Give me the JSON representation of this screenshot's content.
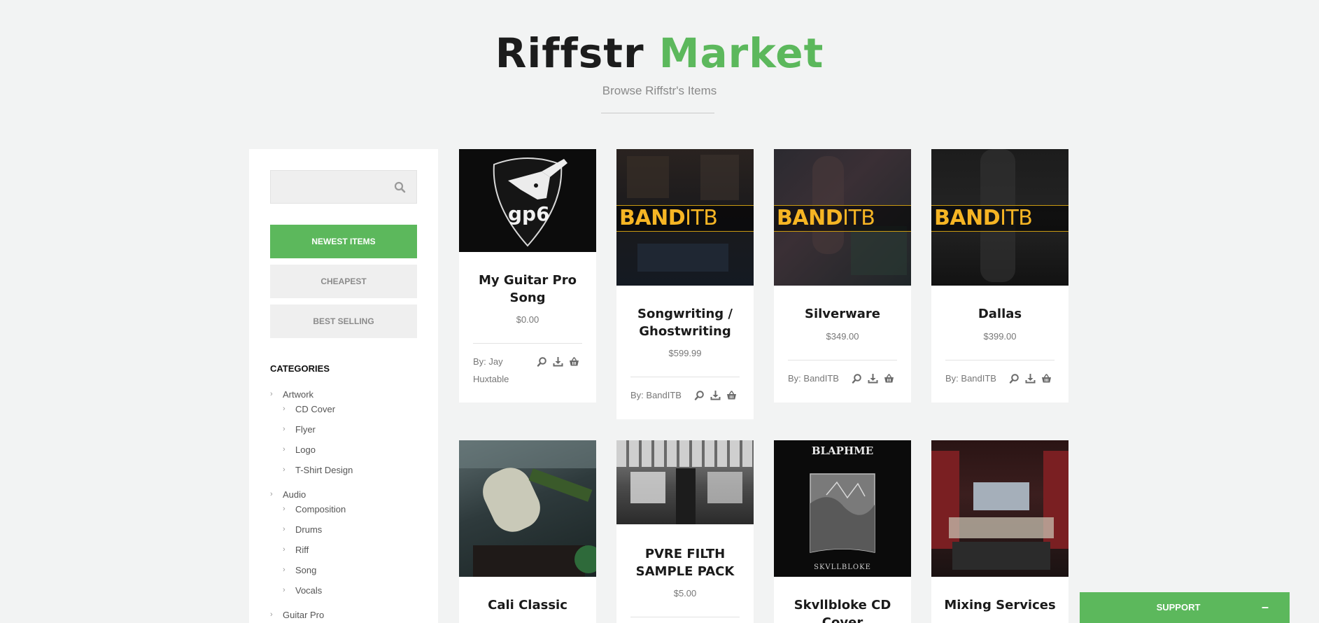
{
  "header": {
    "title_part1": "Riffstr",
    "title_part2": "Market",
    "subtitle": "Browse Riffstr's Items"
  },
  "search": {
    "placeholder": ""
  },
  "sort_buttons": [
    "NEWEST ITEMS",
    "CHEAPEST",
    "BEST SELLING"
  ],
  "categories": {
    "title": "CATEGORIES",
    "groups": [
      {
        "label": "Artwork",
        "children": [
          "CD Cover",
          "Flyer",
          "Logo",
          "T-Shirt Design"
        ]
      },
      {
        "label": "Audio",
        "children": [
          "Composition",
          "Drums",
          "Riff",
          "Song",
          "Vocals"
        ]
      },
      {
        "label": "Guitar Pro",
        "children": []
      }
    ]
  },
  "items": [
    {
      "title": "My Guitar Pro Song",
      "price": "$0.00",
      "seller": "By: Jay Huxtable",
      "image": "gp6-guitar-pick-logo"
    },
    {
      "title": "Songwriting / Ghostwriting",
      "price": "$599.99",
      "seller": "By: BandITB",
      "image": "banditb-studio-banner",
      "banner": [
        "BAND",
        "ITB"
      ]
    },
    {
      "title": "Silverware",
      "price": "$349.00",
      "seller": "By: BandITB",
      "image": "banditb-guitarist-banner",
      "banner": [
        "BAND",
        "ITB"
      ]
    },
    {
      "title": "Dallas",
      "price": "$399.00",
      "seller": "By: BandITB",
      "image": "banditb-stage-banner",
      "banner": [
        "BAND",
        "ITB"
      ]
    },
    {
      "title": "Cali Classic",
      "price": "",
      "seller": "",
      "image": "guitarist-jumping-photo"
    },
    {
      "title": "PVRE FILTH SAMPLE PACK",
      "price": "$5.00",
      "seller": "",
      "image": "abandoned-factory-photo"
    },
    {
      "title": "Skvllbloke CD Cover",
      "price": "",
      "seller": "",
      "image": "skvllbloke-cd-artwork",
      "artwork_texts": [
        "BLAPHME",
        "SKVLLBLOKE"
      ]
    },
    {
      "title": "Mixing Services",
      "price": "",
      "seller": "",
      "image": "recording-studio-photo"
    }
  ],
  "gp6_logo_text": "gp6",
  "support": {
    "label": "SUPPORT",
    "minimize": "–"
  },
  "colors": {
    "accent": "#5cb85c",
    "background": "#f2f3f3",
    "banner_yellow": "#f6b524"
  },
  "icons": [
    "search-icon",
    "chevron-right-icon",
    "preview-icon",
    "download-icon",
    "basket-icon",
    "minimize-icon"
  ]
}
